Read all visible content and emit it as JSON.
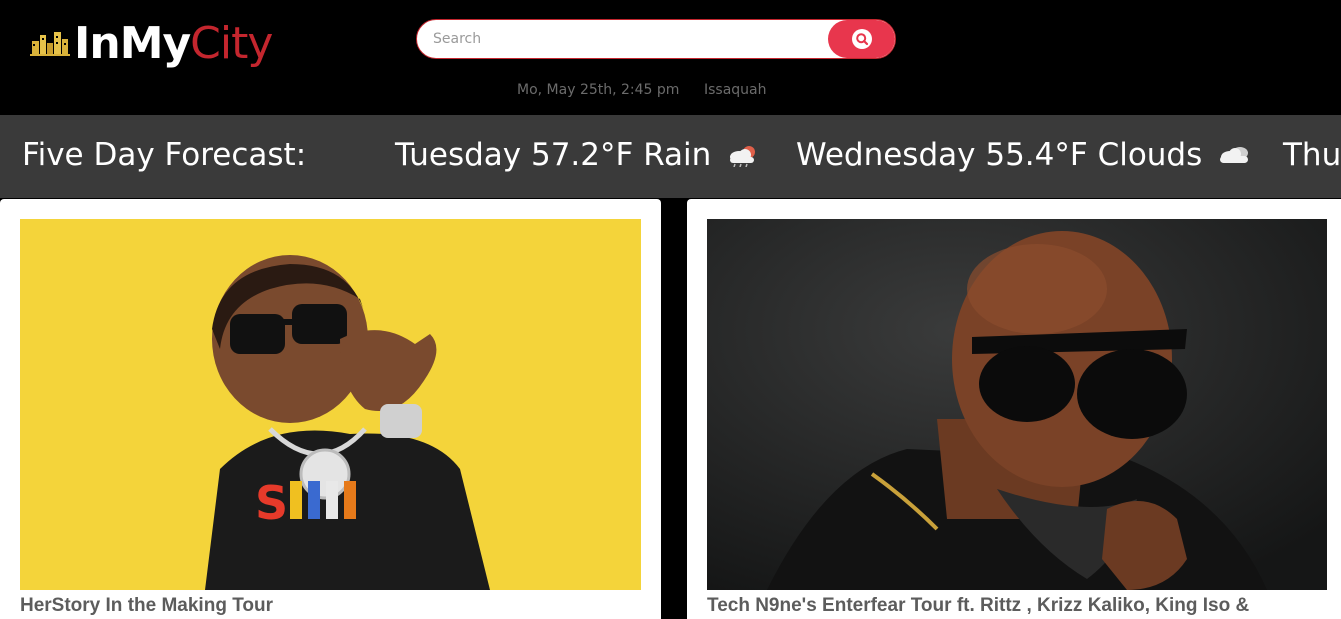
{
  "brand": {
    "name_part1": "InMy",
    "name_part2": "City"
  },
  "search": {
    "placeholder": "Search"
  },
  "info": {
    "datetime": "Mo, May 25th, 2:45 pm",
    "location": "Issaquah"
  },
  "forecast": {
    "title": "Five Day Forecast:",
    "days": [
      {
        "day": "Tuesday",
        "temp": "57.2°F",
        "condition": "Rain",
        "icon": "rain-cloud-icon"
      },
      {
        "day": "Wednesday",
        "temp": "55.4°F",
        "condition": "Clouds",
        "icon": "cloud-icon"
      },
      {
        "day": "Thu",
        "temp": "",
        "condition": "",
        "icon": ""
      }
    ]
  },
  "events": [
    {
      "title": "HerStory In the Making Tour",
      "image": "performer-photo-yellow-background"
    },
    {
      "title": "Tech N9ne's Enterfear Tour ft. Rittz , Krizz Kaliko, King Iso &",
      "image": "performer-photo-dark-background"
    }
  ],
  "colors": {
    "accent": "#c4262e",
    "search_button": "#e8364d",
    "forecast_bar": "#3a3a3a",
    "header": "#000000"
  }
}
